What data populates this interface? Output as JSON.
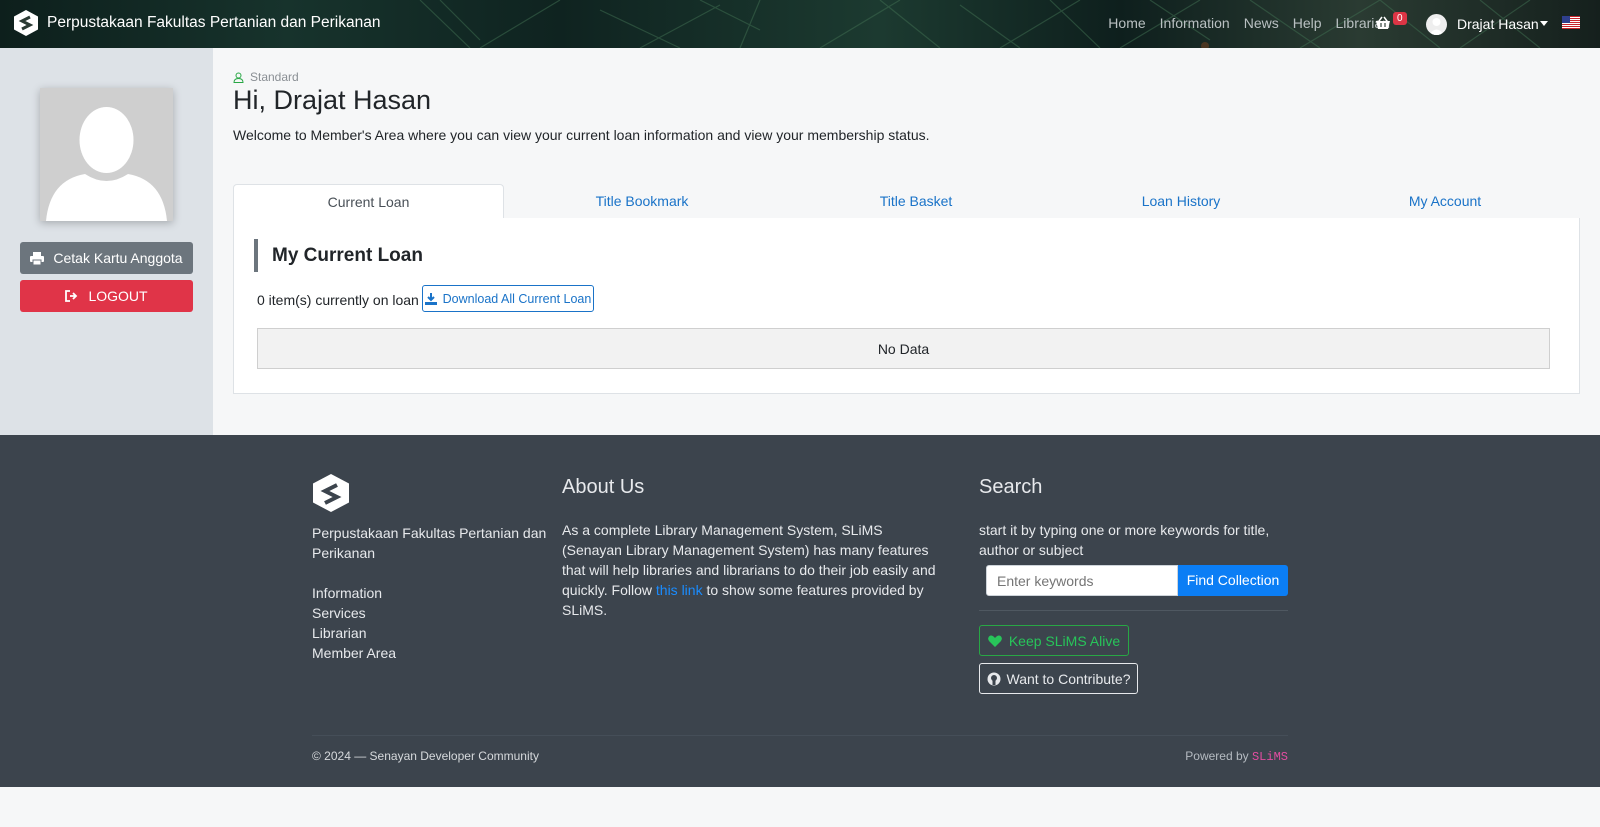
{
  "navbar": {
    "title": "Perpustakaan Fakultas Pertanian dan Perikanan",
    "links": [
      "Home",
      "Information",
      "News",
      "Help",
      "Librarian"
    ],
    "basket_count": "0",
    "user_name": "Drajat Hasan",
    "icons": {
      "logo": "slims-logo-icon",
      "basket": "basket-icon",
      "flag": "us-flag-icon"
    }
  },
  "sidebar": {
    "print_label": "Cetak Kartu Anggota",
    "logout_label": "LOGOUT"
  },
  "main": {
    "member_type": "Standard",
    "greeting": "Hi, Drajat Hasan",
    "welcome": "Welcome to Member's Area where you can view your current loan information and view your membership status.",
    "tabs": [
      "Current Loan",
      "Title Bookmark",
      "Title Basket",
      "Loan History",
      "My Account"
    ],
    "active_tab": "Current Loan",
    "panel_title": "My Current Loan",
    "loan_count": "0 item(s) currently on loan |",
    "download_label": "Download All Current Loan",
    "no_data": "No Data"
  },
  "footer": {
    "library_name": "Perpustakaan Fakultas Pertanian dan Perikanan",
    "links": [
      "Information",
      "Services",
      "Librarian",
      "Member Area"
    ],
    "about_title": "About Us",
    "about_text_before": "As a complete Library Management System, SLiMS (Senayan Library Management System) has many features that will help libraries and librarians to do their job easily and quickly. Follow ",
    "about_link": "this link",
    "about_text_after": " to show some features provided by SLiMS.",
    "search_title": "Search",
    "search_text": "start it by typing one or more keywords for title, author or subject",
    "search_placeholder": "Enter keywords",
    "search_button": "Find Collection",
    "alive_label": "Keep SLiMS Alive",
    "contribute_label": "Want to Contribute?",
    "copyright": "© 2024 — Senayan Developer Community",
    "powered_by": "Powered by",
    "powered_name": "SLiMS",
    "colors": {
      "accent": "#0b7ef5",
      "danger": "#e03448",
      "success": "#28a745",
      "footer_bg": "#3c444d"
    }
  }
}
